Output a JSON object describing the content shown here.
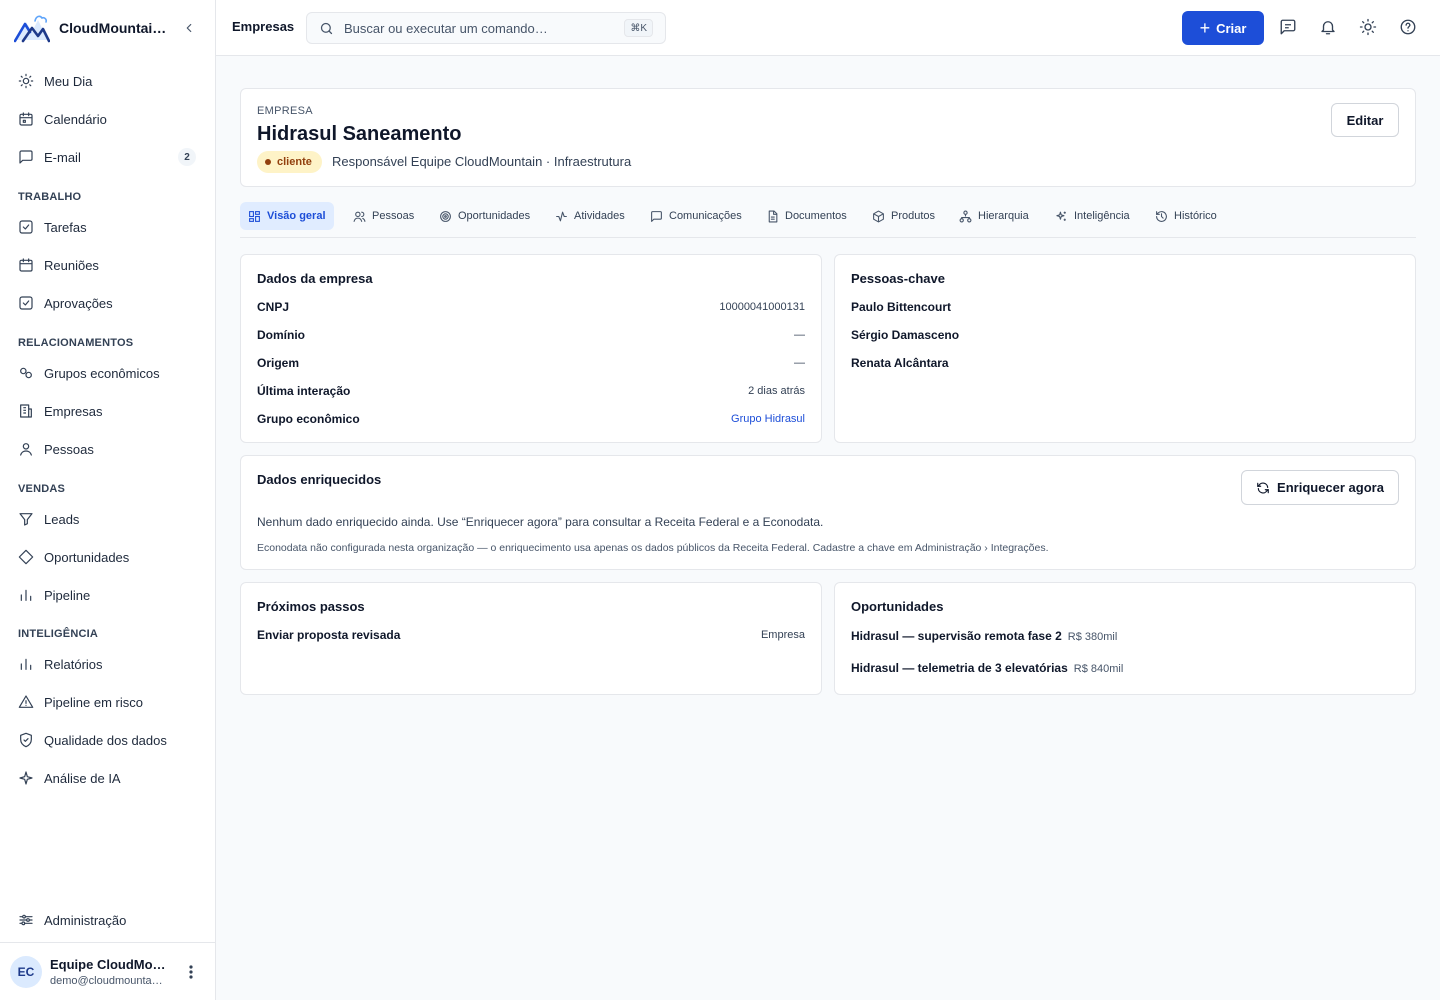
{
  "sidebar": {
    "brand": "CloudMountai…",
    "items": {
      "meu_dia": "Meu Dia",
      "calendario": "Calendário",
      "email": "E-mail",
      "email_badge": "2",
      "tarefas": "Tarefas",
      "reunioes": "Reuniões",
      "aprovacoes": "Aprovações",
      "grupos": "Grupos econômicos",
      "empresas": "Empresas",
      "pessoas": "Pessoas",
      "leads": "Leads",
      "oportunidades": "Oportunidades",
      "pipeline": "Pipeline",
      "relatorios": "Relatórios",
      "pipeline_risco": "Pipeline em risco",
      "qualidade": "Qualidade dos dados",
      "analise_ia": "Análise de IA",
      "administracao": "Administração"
    },
    "sections": {
      "trabalho": "TRABALHO",
      "relacionamentos": "RELACIONAMENTOS",
      "vendas": "VENDAS",
      "inteligencia": "INTELIGÊNCIA"
    },
    "user": {
      "initials": "EC",
      "name": "Equipe CloudMo…",
      "email": "demo@cloudmounta…"
    }
  },
  "topbar": {
    "title": "Empresas",
    "search_placeholder": "Buscar ou executar um comando…",
    "shortcut": "⌘K",
    "create_label": "Criar"
  },
  "header": {
    "eyebrow": "EMPRESA",
    "title": "Hidrasul Saneamento",
    "status": "cliente",
    "subline": "Responsável Equipe CloudMountain · Infraestrutura",
    "edit_label": "Editar"
  },
  "tabs": {
    "visao_geral": "Visão geral",
    "pessoas": "Pessoas",
    "oportunidades": "Oportunidades",
    "atividades": "Atividades",
    "comunicacoes": "Comunicações",
    "documentos": "Documentos",
    "produtos": "Produtos",
    "hierarquia": "Hierarquia",
    "inteligencia": "Inteligência",
    "historico": "Histórico"
  },
  "company_data": {
    "title": "Dados da empresa",
    "rows": [
      {
        "label": "CNPJ",
        "value": "10000041000131"
      },
      {
        "label": "Domínio",
        "value": "—"
      },
      {
        "label": "Origem",
        "value": "—"
      },
      {
        "label": "Última interação",
        "value": "2 dias atrás"
      },
      {
        "label": "Grupo econômico",
        "value": "Grupo Hidrasul"
      }
    ]
  },
  "key_people": {
    "title": "Pessoas-chave",
    "people": [
      "Paulo Bittencourt",
      "Sérgio Damasceno",
      "Renata Alcântara"
    ]
  },
  "enriched": {
    "title": "Dados enriquecidos",
    "button": "Enriquecer agora",
    "message": "Nenhum dado enriquecido ainda. Use “Enriquecer agora” para consultar a Receita Federal e a Econodata.",
    "note": "Econodata não configurada nesta organização — o enriquecimento usa apenas os dados públicos da Receita Federal. Cadastre a chave em Administração › Integrações."
  },
  "next_steps": {
    "title": "Próximos passos",
    "items": [
      {
        "label": "Enviar proposta revisada",
        "tag": "Empresa"
      }
    ]
  },
  "opportunities": {
    "title": "Oportunidades",
    "items": [
      {
        "name": "Hidrasul — supervisão remota fase 2",
        "amount": "R$ 380mil"
      },
      {
        "name": "Hidrasul — telemetria de 3 elevatórias",
        "amount": "R$ 840mil"
      }
    ]
  },
  "colors": {
    "accent": "#1d4ed8",
    "status_bg": "#fef3c7",
    "status_fg": "#92400e"
  }
}
